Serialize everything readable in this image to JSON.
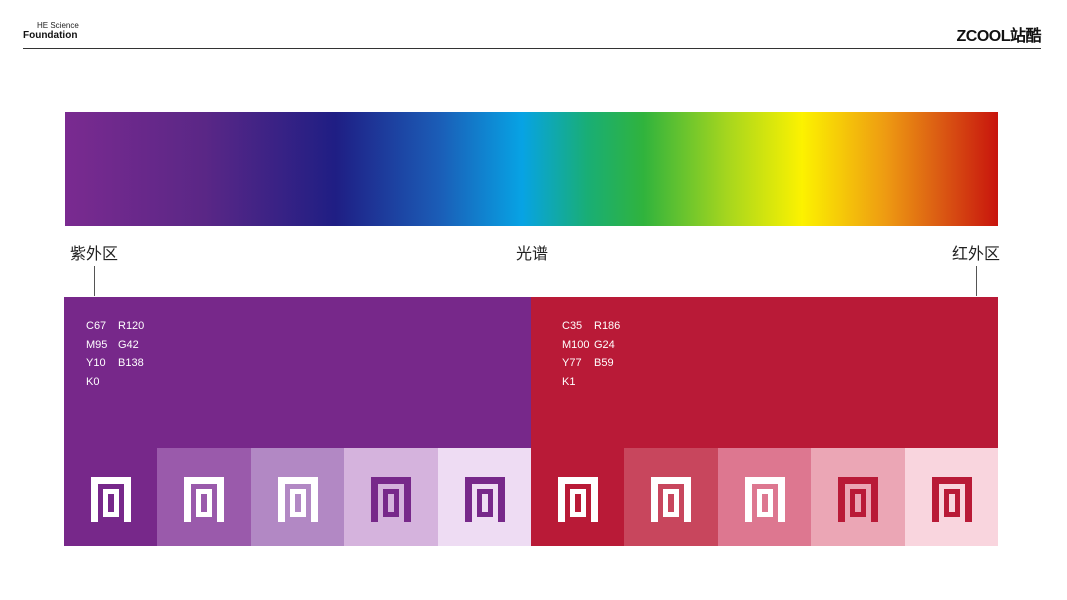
{
  "header": {
    "brand_small": "HE Science",
    "brand_big": "Foundation",
    "zcool_logo": "ZCOOL站酷"
  },
  "spectrum": {
    "left_label": "紫外区",
    "center_label": "光谱",
    "right_label": "红外区"
  },
  "colors": {
    "purple": "#77288a",
    "red": "#b91a37"
  },
  "purple_spec": {
    "rows": [
      {
        "cmyk": "C67",
        "rgb": "R120"
      },
      {
        "cmyk": "M95",
        "rgb": "G42"
      },
      {
        "cmyk": "Y10",
        "rgb": "B138"
      },
      {
        "cmyk": "K0",
        "rgb": ""
      }
    ]
  },
  "red_spec": {
    "rows": [
      {
        "cmyk": "C35",
        "rgb": "R186"
      },
      {
        "cmyk": "M100",
        "rgb": "G24"
      },
      {
        "cmyk": "Y77",
        "rgb": "B59"
      },
      {
        "cmyk": "K1",
        "rgb": ""
      }
    ]
  },
  "swatches": [
    {
      "bg": "#77288a",
      "fg": "#ffffff"
    },
    {
      "bg": "#9a5aab",
      "fg": "#ffffff"
    },
    {
      "bg": "#b288c4",
      "fg": "#ffffff"
    },
    {
      "bg": "#d5b3dd",
      "fg": "#77288a"
    },
    {
      "bg": "#eedcf3",
      "fg": "#77288a"
    },
    {
      "bg": "#b91a37",
      "fg": "#ffffff"
    },
    {
      "bg": "#c8465d",
      "fg": "#ffffff"
    },
    {
      "bg": "#dd7790",
      "fg": "#ffffff"
    },
    {
      "bg": "#eba6b5",
      "fg": "#b91a37"
    },
    {
      "bg": "#f9d5de",
      "fg": "#b91a37"
    }
  ]
}
